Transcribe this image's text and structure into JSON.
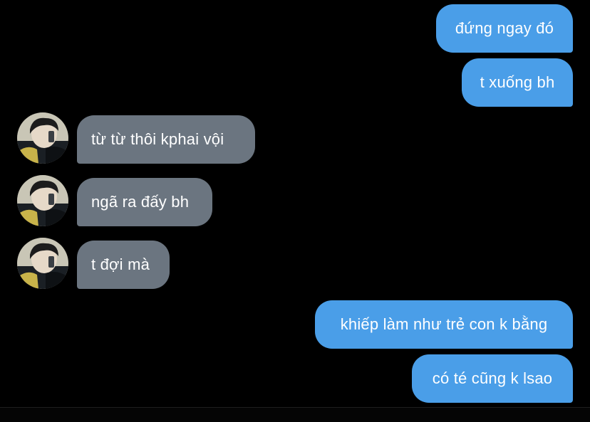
{
  "conversation": {
    "messages": [
      {
        "direction": "outgoing",
        "text": "đứng ngay đó"
      },
      {
        "direction": "outgoing",
        "text": "t xuống bh"
      },
      {
        "direction": "incoming",
        "text": "từ từ thôi kphai vội"
      },
      {
        "direction": "incoming",
        "text": "ngã ra đấy bh"
      },
      {
        "direction": "incoming",
        "text": "t đợi mà"
      },
      {
        "direction": "outgoing",
        "text": "khiếp làm như trẻ con k bằng"
      },
      {
        "direction": "outgoing",
        "text": "có té cũng k lsao"
      }
    ]
  },
  "colors": {
    "background": "#000000",
    "outgoing_bubble": "#4a9ee8",
    "incoming_bubble": "#6b7580",
    "text": "#ffffff"
  },
  "icons": {
    "avatar": "contact-avatar-photo"
  }
}
